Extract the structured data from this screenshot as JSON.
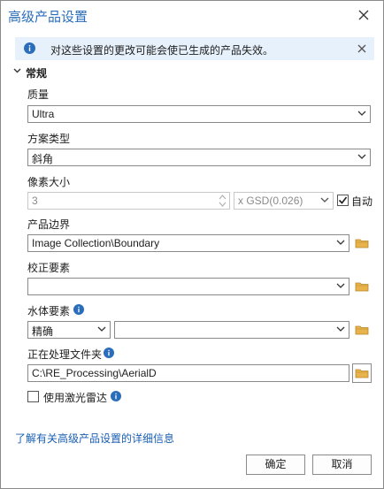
{
  "window": {
    "title": "高级产品设置"
  },
  "banner": {
    "message": "对这些设置的更改可能会使已生成的产品失效。"
  },
  "section": {
    "title": "常规"
  },
  "quality": {
    "label": "质量",
    "value": "Ultra"
  },
  "scheme": {
    "label": "方案类型",
    "value": "斜角"
  },
  "pixel_size": {
    "label": "像素大小",
    "value": "3",
    "unit_value": "x GSD(0.026)",
    "auto_label": "自动",
    "auto_checked": true
  },
  "product_boundary": {
    "label": "产品边界",
    "value": "Image Collection\\Boundary"
  },
  "correction": {
    "label": "校正要素",
    "value": ""
  },
  "water": {
    "label": "水体要素",
    "mode_value": "精确",
    "feature_value": ""
  },
  "processing_folder": {
    "label": "正在处理文件夹",
    "value": "C:\\RE_Processing\\AerialD"
  },
  "lidar": {
    "label": "使用激光雷达",
    "checked": false
  },
  "footer": {
    "link": "了解有关高级产品设置的详细信息",
    "ok_label": "确定",
    "cancel_label": "取消"
  },
  "colors": {
    "accent": "#2a6ebb",
    "info_bg": "#e6f1fb",
    "link": "#1a5fb4",
    "folder": "#e8b34a"
  }
}
